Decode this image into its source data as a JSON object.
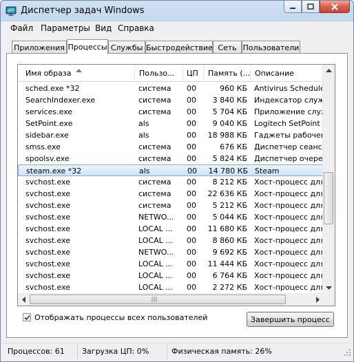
{
  "window": {
    "title": "Диспетчер задач Windows",
    "accent": "#c4d8ee",
    "close_color": "#c84430",
    "app_icon": "task-manager-icon"
  },
  "menu": [
    {
      "label": "Файл"
    },
    {
      "label": "Параметры"
    },
    {
      "label": "Вид"
    },
    {
      "label": "Справка"
    }
  ],
  "tabs": [
    {
      "label": "Приложения"
    },
    {
      "label": "Процессы"
    },
    {
      "label": "Службы"
    },
    {
      "label": "Быстродействие"
    },
    {
      "label": "Сеть"
    },
    {
      "label": "Пользователи"
    }
  ],
  "active_tab": "Процессы",
  "table": {
    "columns": [
      "Имя образа",
      "Пользо...",
      "ЦП",
      "Память (...",
      "Описание"
    ],
    "sorted_column": "Имя образа",
    "rows": [
      {
        "name": "sched.exe *32",
        "user": "система",
        "cpu": "00",
        "mem": "960 КБ",
        "desc": "Antivirus Scheduler"
      },
      {
        "name": "SearchIndexer.exe",
        "user": "система",
        "cpu": "00",
        "mem": "3 840 КБ",
        "desc": "Индексатор службы"
      },
      {
        "name": "services.exe",
        "user": "система",
        "cpu": "00",
        "mem": "5 704 КБ",
        "desc": "Приложение служб"
      },
      {
        "name": "SetPoint.exe",
        "user": "als",
        "cpu": "00",
        "mem": "9 040 КБ",
        "desc": "Logitech SetPoint Ev"
      },
      {
        "name": "sidebar.exe",
        "user": "als",
        "cpu": "00",
        "mem": "18 988 КБ",
        "desc": "Гаджеты рабочего"
      },
      {
        "name": "smss.exe",
        "user": "система",
        "cpu": "00",
        "mem": "676 КБ",
        "desc": "Диспетчер сеанса"
      },
      {
        "name": "spoolsv.exe",
        "user": "система",
        "cpu": "00",
        "mem": "5 824 КБ",
        "desc": "Диспетчер очереди"
      },
      {
        "name": "steam.exe *32",
        "user": "als",
        "cpu": "00",
        "mem": "14 780 КБ",
        "desc": "Steam",
        "selected": true
      },
      {
        "name": "svchost.exe",
        "user": "система",
        "cpu": "00",
        "mem": "8 212 КБ",
        "desc": "Хост-процесс для с"
      },
      {
        "name": "svchost.exe",
        "user": "система",
        "cpu": "00",
        "mem": "22 636 КБ",
        "desc": "Хост-процесс для с"
      },
      {
        "name": "svchost.exe",
        "user": "система",
        "cpu": "00",
        "mem": "5 212 КБ",
        "desc": "Хост-процесс для с"
      },
      {
        "name": "svchost.exe",
        "user": "NETWO...",
        "cpu": "00",
        "mem": "5 044 КБ",
        "desc": "Хост-процесс для с"
      },
      {
        "name": "svchost.exe",
        "user": "LOCAL ...",
        "cpu": "00",
        "mem": "11 680 КБ",
        "desc": "Хост-процесс для с"
      },
      {
        "name": "svchost.exe",
        "user": "LOCAL ...",
        "cpu": "00",
        "mem": "8 860 КБ",
        "desc": "Хост-процесс для с"
      },
      {
        "name": "svchost.exe",
        "user": "NETWO...",
        "cpu": "00",
        "mem": "9 692 КБ",
        "desc": "Хост-процесс для с"
      },
      {
        "name": "svchost.exe",
        "user": "LOCAL ...",
        "cpu": "00",
        "mem": "11 444 КБ",
        "desc": "Хост-процесс для с"
      },
      {
        "name": "svchost.exe",
        "user": "LOCAL ...",
        "cpu": "00",
        "mem": "6 764 КБ",
        "desc": "Хост-процесс для с"
      },
      {
        "name": "svchost.exe",
        "user": "LOCAL ...",
        "cpu": "00",
        "mem": "2 272 КБ",
        "desc": "Хост-процесс для с"
      }
    ]
  },
  "show_all_users": {
    "label": "Отображать процессы всех пользователей",
    "checked": true
  },
  "end_process_label": "Завершить процесс",
  "status": {
    "processes": "Процессов: 61",
    "cpu": "Загрузка ЦП: 0%",
    "memory": "Физическая память: 26%"
  }
}
